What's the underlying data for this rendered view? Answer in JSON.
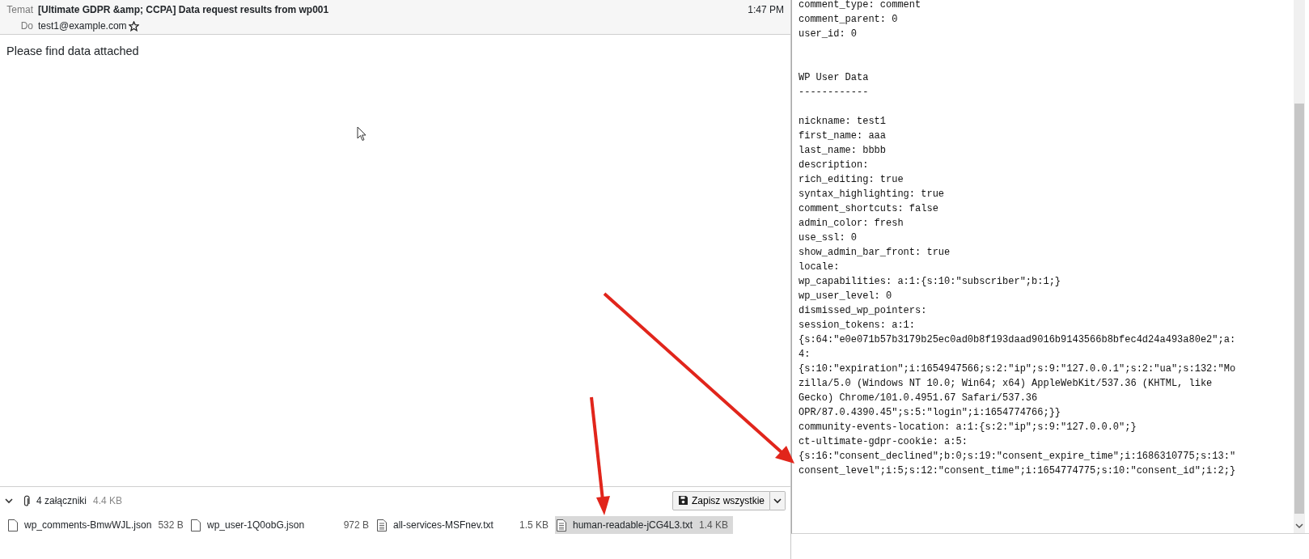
{
  "email": {
    "subject_label": "Temat",
    "subject": "[Ultimate GDPR &amp; CCPA] Data request results from wp001",
    "time": "1:47 PM",
    "to_label": "Do",
    "to": "test1@example.com",
    "starred": false,
    "body": "Please find data attached"
  },
  "attachments": {
    "expanded": true,
    "summary": "4 załączniki",
    "total_size": "4.4 KB",
    "save_all": "Zapisz wszystkie",
    "files": [
      {
        "name": "wp_comments-BmwWJL.json",
        "size": "532 B",
        "kind": "json",
        "selected": false
      },
      {
        "name": "wp_user-1Q0obG.json",
        "size": "972 B",
        "kind": "json",
        "selected": false
      },
      {
        "name": "all-services-MSFnev.txt",
        "size": "1.5 KB",
        "kind": "text",
        "selected": false
      },
      {
        "name": "human-readable-jCG4L3.txt",
        "size": "1.4 KB",
        "kind": "text",
        "selected": true
      }
    ]
  },
  "viewer": {
    "sections": [
      {
        "lines": [
          "comment_type: comment",
          "comment_parent: 0",
          "user_id: 0"
        ]
      },
      {
        "heading": "WP User Data",
        "underline": "------------",
        "lines": [
          "nickname: test1",
          "first_name: aaa",
          "last_name: bbbb",
          "description:",
          "rich_editing: true",
          "syntax_highlighting: true",
          "comment_shortcuts: false",
          "admin_color: fresh",
          "use_ssl: 0",
          "show_admin_bar_front: true",
          "locale:",
          "wp_capabilities: a:1:{s:10:\"subscriber\";b:1;}",
          "wp_user_level: 0",
          "dismissed_wp_pointers:",
          "session_tokens: a:1:",
          "{s:64:\"e0e071b57b3179b25ec0ad0b8f193daad9016b9143566b8bfec4d24a493a80e2\";a:",
          "4:",
          "{s:10:\"expiration\";i:1654947566;s:2:\"ip\";s:9:\"127.0.0.1\";s:2:\"ua\";s:132:\"Mo",
          "zilla/5.0 (Windows NT 10.0; Win64; x64) AppleWebKit/537.36 (KHTML, like",
          "Gecko) Chrome/101.0.4951.67 Safari/537.36",
          "OPR/87.0.4390.45\";s:5:\"login\";i:1654774766;}}",
          "community-events-location: a:1:{s:2:\"ip\";s:9:\"127.0.0.0\";}",
          "ct-ultimate-gdpr-cookie: a:5:",
          "{s:16:\"consent_declined\";b:0;s:19:\"consent_expire_time\";i:1686310775;s:13:\"",
          "consent_level\";i:5;s:12:\"consent_time\";i:1654774775;s:10:\"consent_id\";i:2;}"
        ]
      }
    ]
  }
}
